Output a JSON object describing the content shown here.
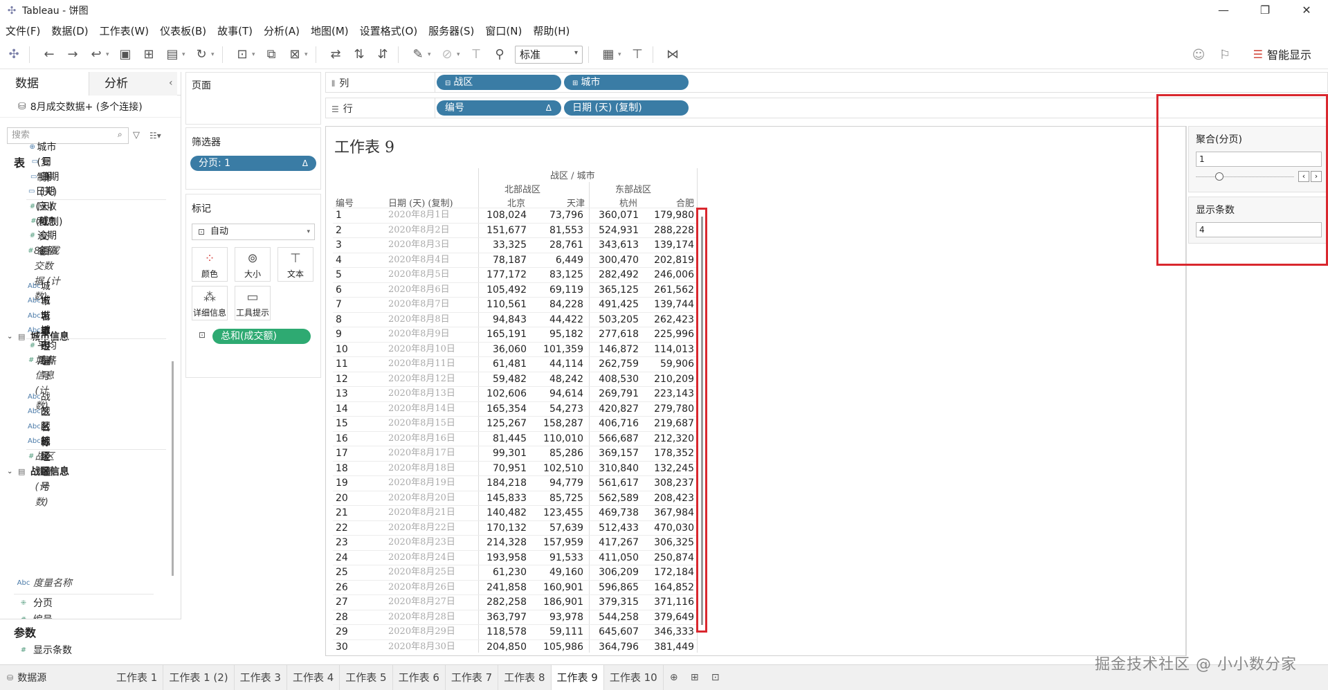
{
  "window": {
    "title": "Tableau - 饼图",
    "min": "—",
    "restore": "❐",
    "close": "✕"
  },
  "menu": [
    "文件(F)",
    "数据(D)",
    "工作表(W)",
    "仪表板(B)",
    "故事(T)",
    "分析(A)",
    "地图(M)",
    "设置格式(O)",
    "服务器(S)",
    "窗口(N)",
    "帮助(H)"
  ],
  "toolbar": {
    "fit_value": "标准",
    "smart_label": "智能显示"
  },
  "left": {
    "tab_data": "数据",
    "tab_analysis": "分析",
    "source": "8月成交数据+ (多个连接)",
    "search_placeholder": "搜索",
    "section_tables": "表",
    "fields_top": [
      {
        "type": "⊕",
        "name": "城市 (复制)",
        "italic": false,
        "dim": true
      },
      {
        "type": "▭",
        "name": "日期",
        "italic": false,
        "dim": true
      },
      {
        "type": "▭",
        "name": "日期 (天)",
        "italic": false,
        "dim": true
      },
      {
        "type": "▭",
        "name": "日期 (天) (复制)",
        "italic": false,
        "dim": true
      },
      {
        "type": "#",
        "name": "应收利息",
        "italic": false,
        "dim": false
      },
      {
        "type": "#",
        "name": "成交额",
        "italic": false,
        "dim": false
      },
      {
        "type": "#",
        "name": "逾期金额",
        "italic": false,
        "dim": false
      },
      {
        "type": "#",
        "name": "8月成交数据 (计数)",
        "italic": true,
        "dim": false
      }
    ],
    "group_city": "城市信息",
    "fields_city": [
      {
        "type": "Abc",
        "name": "城市名称",
        "italic": false,
        "dim": true
      },
      {
        "type": "Abc",
        "name": "城市等级",
        "italic": false,
        "dim": true
      },
      {
        "type": "Abc",
        "name": "城市经理",
        "italic": false,
        "dim": true
      },
      {
        "type": "Abc",
        "name": "城市编号",
        "italic": false,
        "dim": true
      },
      {
        "type": "#",
        "name": "平均月薪",
        "italic": false,
        "dim": false
      },
      {
        "type": "#",
        "name": "城市信息 (计数)",
        "italic": true,
        "dim": false
      }
    ],
    "group_zone": "战区信息",
    "fields_zone": [
      {
        "type": "Abc",
        "name": "战区名称",
        "italic": false,
        "dim": true
      },
      {
        "type": "Abc",
        "name": "战区等级",
        "italic": false,
        "dim": true
      },
      {
        "type": "Abc",
        "name": "战区经理",
        "italic": false,
        "dim": true
      },
      {
        "type": "Abc",
        "name": "战区编号",
        "italic": false,
        "dim": true
      },
      {
        "type": "#",
        "name": "战区信息 (计数)",
        "italic": true,
        "dim": false
      }
    ],
    "measure_names": "度量名称",
    "field_page": "分页",
    "field_cutoff": "编号",
    "section_params": "参数",
    "param_field": "显示条数"
  },
  "cards": {
    "pages": "页面",
    "filters": "筛选器",
    "filter_pill": "分页: 1",
    "marks": "标记",
    "marks_type": "自动",
    "mark_buttons": [
      "颜色",
      "大小",
      "文本",
      "详细信息",
      "工具提示"
    ],
    "mark_pill": "总和(成交额)"
  },
  "shelves": {
    "columns_label": "列",
    "rows_label": "行",
    "columns": [
      "战区",
      "城市"
    ],
    "rows": [
      "编号",
      "日期 (天) (复制)"
    ]
  },
  "sheet": {
    "title": "工作表 9",
    "header_top": "战区 / 城市",
    "zone_north": "北部战区",
    "zone_east": "东部战区",
    "col_id": "编号",
    "col_date": "日期 (天) (复制)",
    "cities": [
      "北京",
      "天津",
      "杭州",
      "合肥"
    ],
    "rows": [
      [
        "1",
        "2020年8月1日",
        "108,024",
        "73,796",
        "360,071",
        "179,980"
      ],
      [
        "2",
        "2020年8月2日",
        "151,677",
        "81,553",
        "524,931",
        "288,228"
      ],
      [
        "3",
        "2020年8月3日",
        "33,325",
        "28,761",
        "343,613",
        "139,174"
      ],
      [
        "4",
        "2020年8月4日",
        "78,187",
        "6,449",
        "300,470",
        "202,819"
      ],
      [
        "5",
        "2020年8月5日",
        "177,172",
        "83,125",
        "282,492",
        "246,006"
      ],
      [
        "6",
        "2020年8月6日",
        "105,492",
        "69,119",
        "365,125",
        "261,562"
      ],
      [
        "7",
        "2020年8月7日",
        "110,561",
        "84,228",
        "491,425",
        "139,744"
      ],
      [
        "8",
        "2020年8月8日",
        "94,843",
        "44,422",
        "503,205",
        "262,423"
      ],
      [
        "9",
        "2020年8月9日",
        "165,191",
        "95,182",
        "277,618",
        "225,996"
      ],
      [
        "10",
        "2020年8月10日",
        "36,060",
        "101,359",
        "146,872",
        "114,013"
      ],
      [
        "11",
        "2020年8月11日",
        "61,481",
        "44,114",
        "262,759",
        "59,906"
      ],
      [
        "12",
        "2020年8月12日",
        "59,482",
        "48,242",
        "408,530",
        "210,209"
      ],
      [
        "13",
        "2020年8月13日",
        "102,606",
        "94,614",
        "269,791",
        "223,143"
      ],
      [
        "14",
        "2020年8月14日",
        "165,354",
        "54,273",
        "420,827",
        "279,780"
      ],
      [
        "15",
        "2020年8月15日",
        "125,267",
        "158,287",
        "406,716",
        "219,687"
      ],
      [
        "16",
        "2020年8月16日",
        "81,445",
        "110,010",
        "566,687",
        "212,320"
      ],
      [
        "17",
        "2020年8月17日",
        "99,301",
        "85,286",
        "369,157",
        "178,352"
      ],
      [
        "18",
        "2020年8月18日",
        "70,951",
        "102,510",
        "310,840",
        "132,245"
      ],
      [
        "19",
        "2020年8月19日",
        "184,218",
        "94,779",
        "561,617",
        "308,237"
      ],
      [
        "20",
        "2020年8月20日",
        "145,833",
        "85,725",
        "562,589",
        "208,423"
      ],
      [
        "21",
        "2020年8月21日",
        "140,482",
        "123,455",
        "469,738",
        "367,984"
      ],
      [
        "22",
        "2020年8月22日",
        "170,132",
        "57,639",
        "512,433",
        "470,030"
      ],
      [
        "23",
        "2020年8月23日",
        "214,328",
        "157,959",
        "417,267",
        "306,325"
      ],
      [
        "24",
        "2020年8月24日",
        "193,958",
        "91,533",
        "411,050",
        "250,874"
      ],
      [
        "25",
        "2020年8月25日",
        "61,230",
        "49,160",
        "306,209",
        "172,184"
      ],
      [
        "26",
        "2020年8月26日",
        "241,858",
        "160,901",
        "596,865",
        "164,852"
      ],
      [
        "27",
        "2020年8月27日",
        "282,258",
        "186,901",
        "379,315",
        "371,116"
      ],
      [
        "28",
        "2020年8月28日",
        "363,797",
        "93,978",
        "544,258",
        "379,649"
      ],
      [
        "29",
        "2020年8月29日",
        "118,578",
        "59,111",
        "645,607",
        "346,333"
      ],
      [
        "30",
        "2020年8月30日",
        "204,850",
        "105,986",
        "364,796",
        "381,449"
      ]
    ]
  },
  "params": {
    "agg_title": "聚合(分页)",
    "agg_value": "1",
    "count_title": "显示条数",
    "count_value": "4"
  },
  "tabs": {
    "datasource": "数据源",
    "sheets": [
      "工作表 1",
      "工作表 1 (2)",
      "工作表 3",
      "工作表 4",
      "工作表 5",
      "工作表 6",
      "工作表 7",
      "工作表 8",
      "工作表 9",
      "工作表 10"
    ],
    "active": "工作表 9"
  },
  "watermark": "掘金技术社区 @ 小小数分家"
}
